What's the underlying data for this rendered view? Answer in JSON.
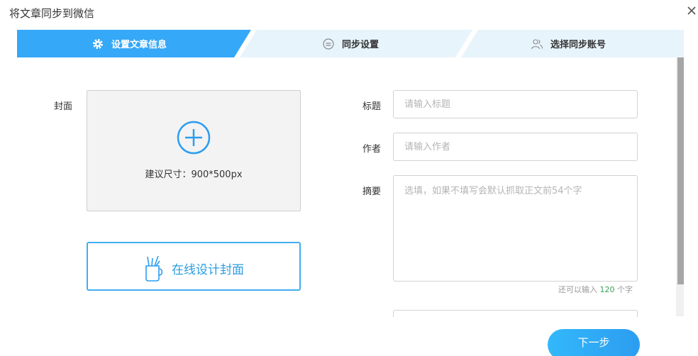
{
  "dialog": {
    "title": "将文章同步到微信",
    "close_icon": "close-icon"
  },
  "steps": [
    {
      "label": "设置文章信息",
      "icon": "gear-icon",
      "active": true
    },
    {
      "label": "同步设置",
      "icon": "sync-settings-icon",
      "active": false
    },
    {
      "label": "选择同步账号",
      "icon": "users-icon",
      "active": false
    }
  ],
  "colors": {
    "accent": "#2c9df0",
    "step_active": "#35a8f7",
    "step_inactive": "#e8f4fc",
    "counter_number": "#3aa15a"
  },
  "cover": {
    "label": "封面",
    "size_hint": "建议尺寸：900*500px",
    "upload_icon": "plus-circle-icon",
    "design_button_label": "在线设计封面",
    "design_icon": "pen-holder-icon"
  },
  "form": {
    "title_label": "标题",
    "title_placeholder": "请输入标题",
    "title_value": "",
    "author_label": "作者",
    "author_placeholder": "请输入作者",
    "author_value": "",
    "summary_label": "摘要",
    "summary_placeholder": "选填，如果不填写会默认抓取正文前54个字",
    "summary_value": "",
    "counter_prefix": "还可以输入",
    "counter_remaining": "120",
    "counter_suffix": "个字"
  },
  "footer": {
    "next_label": "下一步"
  }
}
